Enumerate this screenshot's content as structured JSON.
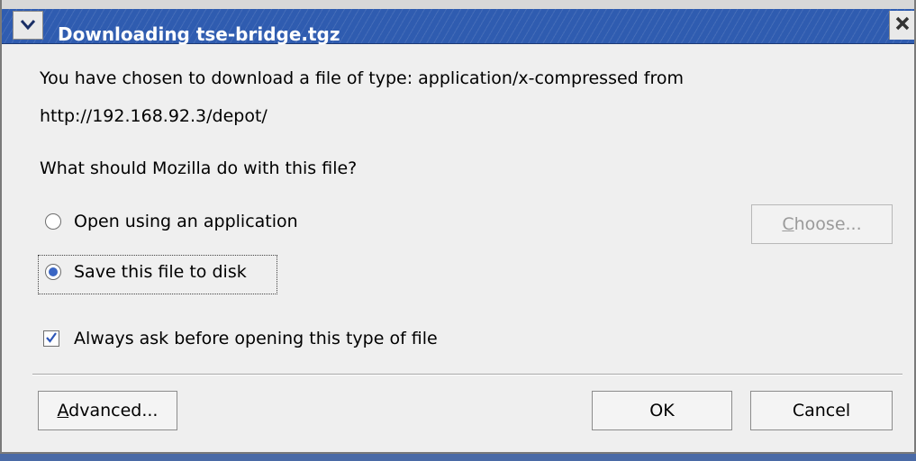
{
  "window": {
    "title": "Downloading tse-bridge.tgz"
  },
  "message": {
    "line1": "You have chosen to download a file of type: application/x-compressed from",
    "line2": "http://192.168.92.3/depot/",
    "question": "What should Mozilla do with this file?"
  },
  "options": {
    "open_label": "Open using an application",
    "save_label": "Save this file to disk",
    "selected": "save"
  },
  "choose_button": "Choose...",
  "always_ask": {
    "label": "Always ask before opening this type of file",
    "checked": true
  },
  "buttons": {
    "advanced": "Advanced...",
    "ok": "OK",
    "cancel": "Cancel"
  },
  "icons": {
    "menu": "chevron-down-icon",
    "close": "close-icon"
  },
  "colors": {
    "titlebar": "#2f5cb0",
    "accent": "#3a66c4"
  }
}
